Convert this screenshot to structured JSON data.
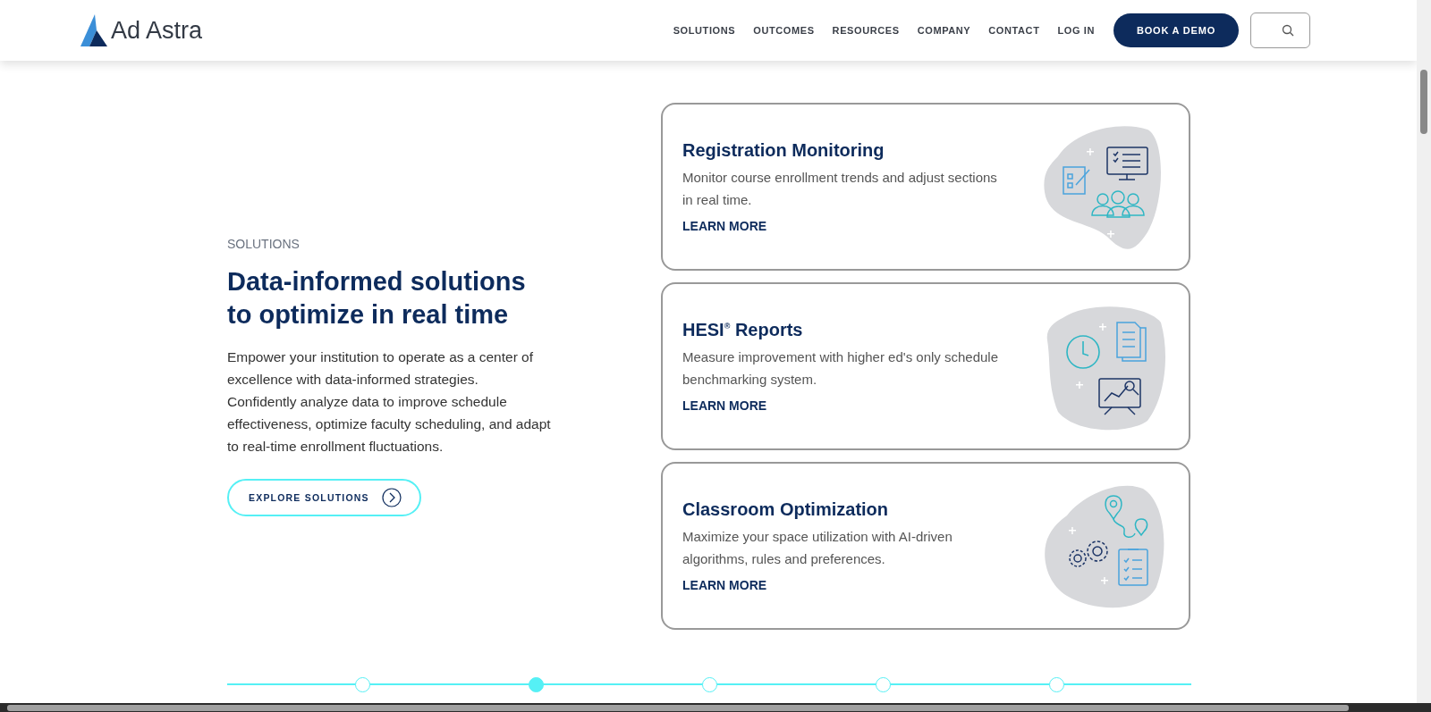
{
  "header": {
    "logo": "Ad Astra",
    "nav": [
      {
        "label": "SOLUTIONS"
      },
      {
        "label": "OUTCOMES"
      },
      {
        "label": "RESOURCES"
      },
      {
        "label": "COMPANY"
      },
      {
        "label": "CONTACT"
      },
      {
        "label": "LOG IN"
      }
    ],
    "cta": "BOOK A DEMO"
  },
  "intro": {
    "eyebrow": "SOLUTIONS",
    "heading": "Data-informed solutions to optimize in real time",
    "body": "Empower your institution to operate as a center of excellence with data-informed strategies. Confidently analyze data to improve schedule effectiveness, optimize faculty scheduling, and adapt to real-time enrollment fluctuations.",
    "button": "EXPLORE SOLUTIONS"
  },
  "cards": [
    {
      "kind": "registration",
      "title": "Registration Monitoring",
      "text": "Monitor course enrollment trends and adjust sections in real time.",
      "link": "LEARN MORE"
    },
    {
      "kind": "reports",
      "title": "HESI$^{®}$ Reports",
      "text": "Measure improvement with higher ed's only schedule benchmarking system.",
      "link": "LEARN MORE"
    },
    {
      "kind": "classroom",
      "title": "Classroom Optimization",
      "text": "Maximize your space utilization with AI-driven algorithms, rules and preferences.",
      "link": "LEARN MORE"
    }
  ],
  "pager": [
    {
      "selected": false
    },
    {
      "selected": true
    },
    {
      "selected": false
    },
    {
      "selected": false
    },
    {
      "selected": false
    }
  ]
}
